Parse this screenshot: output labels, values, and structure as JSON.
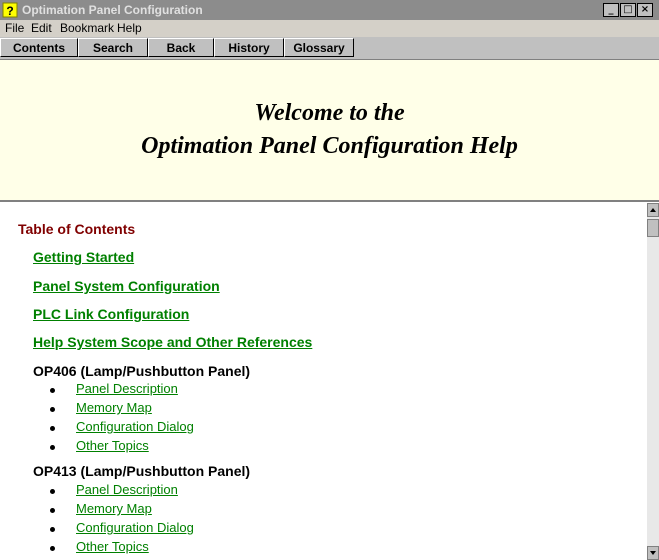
{
  "window": {
    "title": "Optimation Panel Configuration",
    "app_icon": "help-question-icon",
    "controls": [
      "_",
      "□",
      "×"
    ]
  },
  "menubar": {
    "file": "File",
    "edit": "Edit",
    "bookmark": "Bookmark",
    "help": "Help"
  },
  "toolbar": {
    "contents": "Contents",
    "search": "Search",
    "back": "Back",
    "history": "History",
    "glossary": "Glossary"
  },
  "header": {
    "line1": "Welcome to the",
    "line2": "Optimation Panel Configuration Help"
  },
  "toc": {
    "title": "Table of Contents",
    "links": [
      "Getting Started",
      "Panel System Configuration",
      "PLC Link Configuration",
      "Help System Scope and Other References"
    ],
    "panels": [
      {
        "name": "OP406 (Lamp/Pushbutton Panel)",
        "items": [
          "Panel Description",
          "Memory Map",
          "Configuration Dialog",
          "Other Topics"
        ]
      },
      {
        "name": "OP413 (Lamp/Pushbutton Panel)",
        "items": [
          "Panel Description",
          "Memory Map",
          "Configuration Dialog",
          "Other Topics"
        ]
      }
    ]
  },
  "colors": {
    "link": "#008000",
    "toc_title": "#800000",
    "header_bg": "#ffffe8",
    "titlebar_bg": "#8c8c8c"
  }
}
